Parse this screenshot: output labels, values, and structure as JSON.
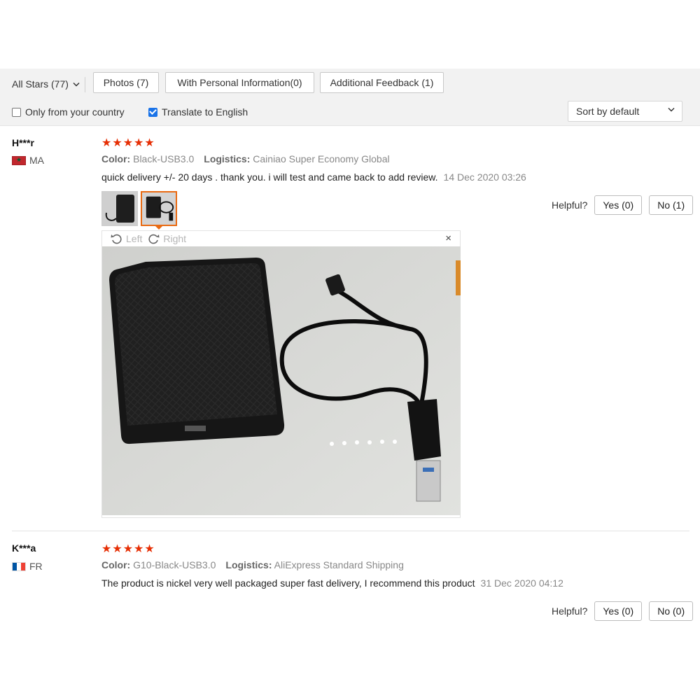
{
  "filters": {
    "stars_label": "All Stars (77)",
    "chips": [
      "Photos (7)",
      "With Personal Information(0)",
      "Additional Feedback (1)"
    ],
    "only_country_label": "Only from your country",
    "only_country_checked": false,
    "translate_label": "Translate to English",
    "translate_checked": true,
    "sort_label": "Sort by default"
  },
  "reviews": [
    {
      "name": "H***r",
      "country": "MA",
      "rating": 5,
      "color_label": "Color:",
      "color_value": "Black-USB3.0",
      "logistics_label": "Logistics:",
      "logistics_value": "Cainiao Super Economy Global",
      "text": "quick delivery +/- 20 days . thank you. i will test and came back to add review.",
      "date": "14 Dec 2020 03:26",
      "helpful_label": "Helpful?",
      "yes_label": "Yes (0)",
      "no_label": "No (1)",
      "viewer": {
        "left_label": "Left",
        "right_label": "Right",
        "close": "×"
      }
    },
    {
      "name": "K***a",
      "country": "FR",
      "rating": 5,
      "color_label": "Color:",
      "color_value": "G10-Black-USB3.0",
      "logistics_label": "Logistics:",
      "logistics_value": "AliExpress Standard Shipping",
      "text": "The product is nickel very well packaged super fast delivery, I recommend this product",
      "date": "31 Dec 2020 04:12",
      "helpful_label": "Helpful?",
      "yes_label": "Yes (0)",
      "no_label": "No (0)"
    }
  ],
  "colors": {
    "star": "#e62e04",
    "thumb_active": "#e96a12",
    "checkbox": "#1a73e8"
  }
}
